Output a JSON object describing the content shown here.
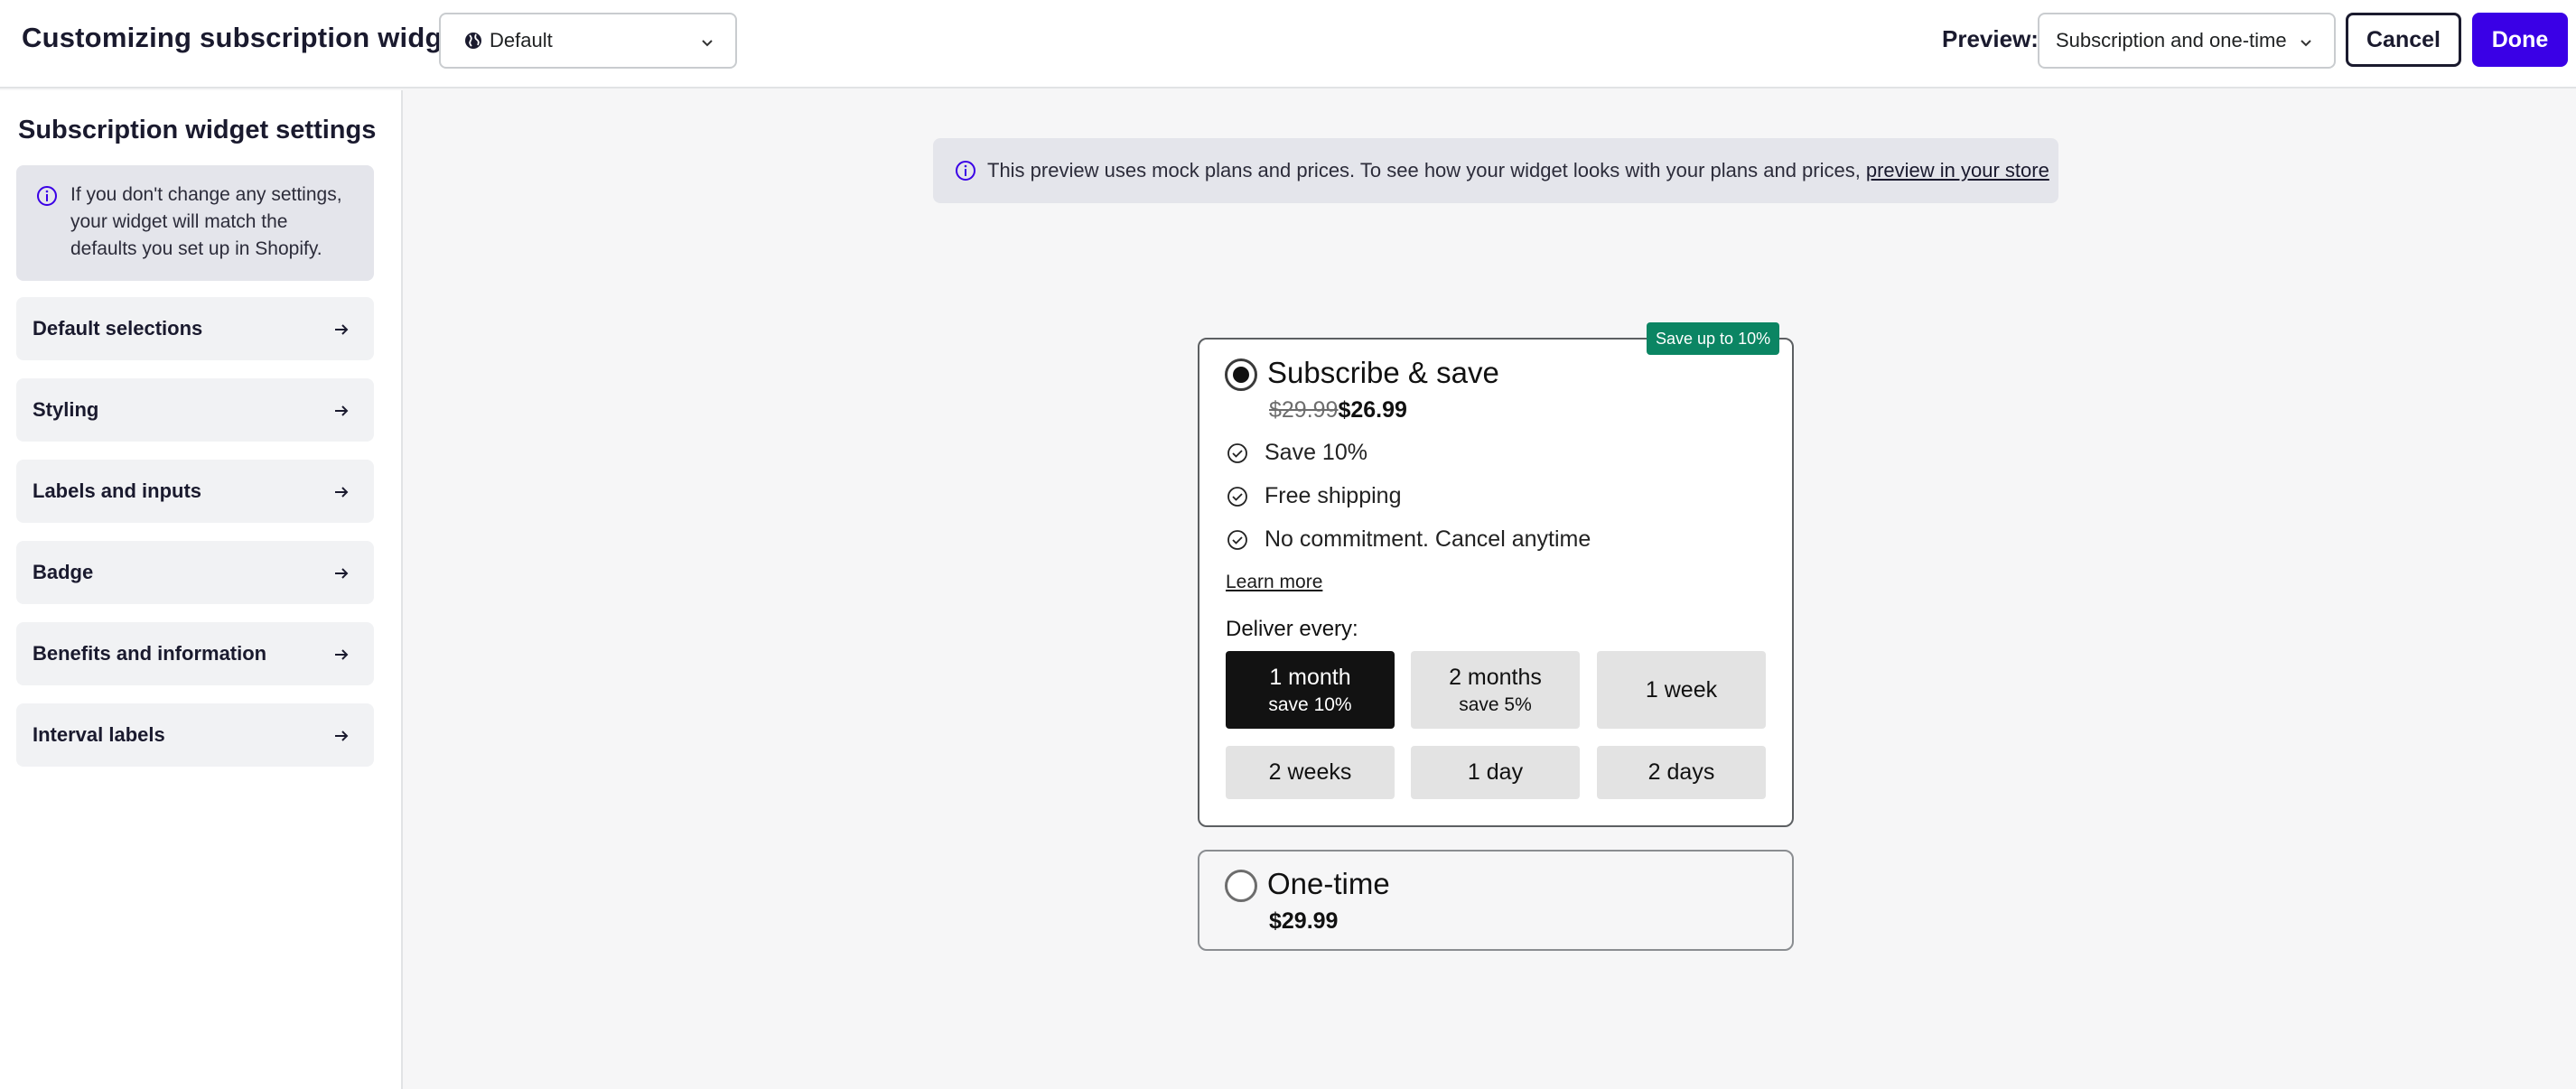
{
  "header": {
    "title": "Customizing subscription widget",
    "theme_select": "Default",
    "preview_label": "Preview:",
    "preview_select": "Subscription and one-time",
    "cancel_label": "Cancel",
    "done_label": "Done"
  },
  "sidebar": {
    "title": "Subscription widget settings",
    "info": "If you don't change any settings, your widget will match the defaults you set up in Shopify.",
    "items": [
      {
        "label": "Default selections"
      },
      {
        "label": "Styling"
      },
      {
        "label": "Labels and inputs"
      },
      {
        "label": "Badge"
      },
      {
        "label": "Benefits and information"
      },
      {
        "label": "Interval labels"
      }
    ]
  },
  "banner": {
    "text": "This preview uses mock plans and prices. To see how your widget looks with your plans and prices,",
    "link": "preview in your store"
  },
  "subscription": {
    "badge": "Save up to 10%",
    "title": "Subscribe & save",
    "old_price": "$29.99",
    "price": "$26.99",
    "benefits": [
      "Save 10%",
      "Free shipping",
      "No commitment. Cancel anytime"
    ],
    "learn_more": "Learn more",
    "deliver_label": "Deliver every:",
    "intervals": [
      {
        "label": "1 month",
        "sub": "save 10%",
        "selected": true
      },
      {
        "label": "2 months",
        "sub": "save 5%",
        "selected": false
      },
      {
        "label": "1 week",
        "sub": "",
        "selected": false
      },
      {
        "label": "2 weeks",
        "sub": "",
        "selected": false
      },
      {
        "label": "1 day",
        "sub": "",
        "selected": false
      },
      {
        "label": "2 days",
        "sub": "",
        "selected": false
      }
    ]
  },
  "one_time": {
    "title": "One-time",
    "price": "$29.99"
  },
  "colors": {
    "accent": "#3a00e6",
    "badge": "#0b8563",
    "selected_interval": "#121212"
  },
  "icons": {
    "theme": "globe-icon",
    "dropdown": "chevron-down-icon",
    "info": "info-icon",
    "nav": "arrow-right-icon",
    "benefit": "check-circle-icon"
  }
}
